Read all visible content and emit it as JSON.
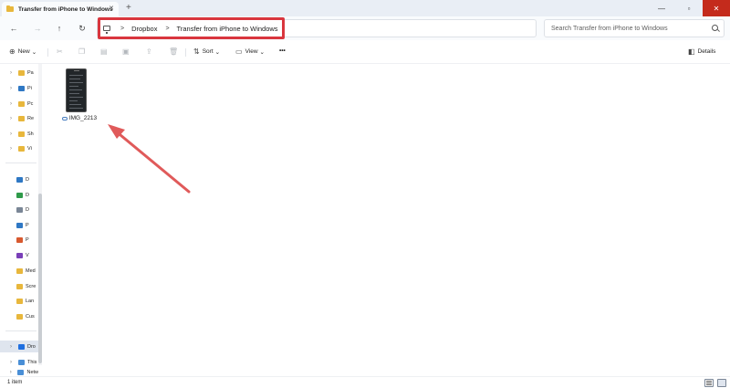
{
  "window": {
    "tab_title": "Transfer from iPhone to Windows",
    "tab_close_glyph": "✕",
    "new_tab_glyph": "+",
    "minimize_glyph": "—",
    "maximize_glyph": "▫",
    "close_glyph": "✕"
  },
  "nav": {
    "back_glyph": "←",
    "forward_glyph": "→",
    "up_glyph": "↑",
    "refresh_glyph": "↻"
  },
  "address": {
    "separator": ">",
    "crumbs": [
      "Dropbox",
      "Transfer from iPhone to Windows"
    ]
  },
  "search": {
    "placeholder": "Search Transfer from iPhone to Windows"
  },
  "commands": {
    "new_label": "New",
    "new_icon": "plus-circle-icon",
    "sort_label": "Sort",
    "view_label": "View",
    "more_glyph": "•••",
    "details_label": "Details",
    "dropdown_glyph": "⌄"
  },
  "sidebar": {
    "items": [
      {
        "label": "Pa",
        "icon": "folder-icon",
        "color": "#e8b73c"
      },
      {
        "label": "Pi",
        "icon": "pictures-icon",
        "color": "#2f78c4"
      },
      {
        "label": "Pc",
        "icon": "folder-icon",
        "color": "#e8b73c"
      },
      {
        "label": "Re",
        "icon": "folder-icon",
        "color": "#e8b73c"
      },
      {
        "label": "Sh",
        "icon": "folder-icon",
        "color": "#e8b73c"
      },
      {
        "label": "Vi",
        "icon": "folder-icon",
        "color": "#e8b73c"
      },
      {
        "label": "D",
        "icon": "desktop-icon",
        "color": "#2f78c4"
      },
      {
        "label": "D",
        "icon": "downloads-icon",
        "color": "#2f9a4a"
      },
      {
        "label": "D",
        "icon": "documents-icon",
        "color": "#7a8696"
      },
      {
        "label": "P",
        "icon": "pictures-icon",
        "color": "#2f78c4"
      },
      {
        "label": "P",
        "icon": "music-icon",
        "color": "#d8592f"
      },
      {
        "label": "V",
        "icon": "videos-icon",
        "color": "#7a3fb8"
      },
      {
        "label": "Med",
        "icon": "folder-icon",
        "color": "#e8b73c"
      },
      {
        "label": "Scre",
        "icon": "folder-icon",
        "color": "#e8b73c"
      },
      {
        "label": "Lan",
        "icon": "folder-icon",
        "color": "#e8b73c"
      },
      {
        "label": "Cus",
        "icon": "folder-icon",
        "color": "#e8b73c"
      },
      {
        "label": "Dro",
        "icon": "dropbox-icon",
        "color": "#1f6fe0"
      },
      {
        "label": "This",
        "icon": "this-pc-icon",
        "color": "#4a8fd6"
      },
      {
        "label": "Netw",
        "icon": "network-icon",
        "color": "#4a8fd6"
      }
    ]
  },
  "files": [
    {
      "name": "IMG_2213",
      "status_icon": "cloud-sync-icon"
    }
  ],
  "status": {
    "item_count": "1 item"
  },
  "colors": {
    "accent": "#2f78c4",
    "highlight_box": "#d9363e",
    "annotation_arrow": "#e05a5a"
  }
}
